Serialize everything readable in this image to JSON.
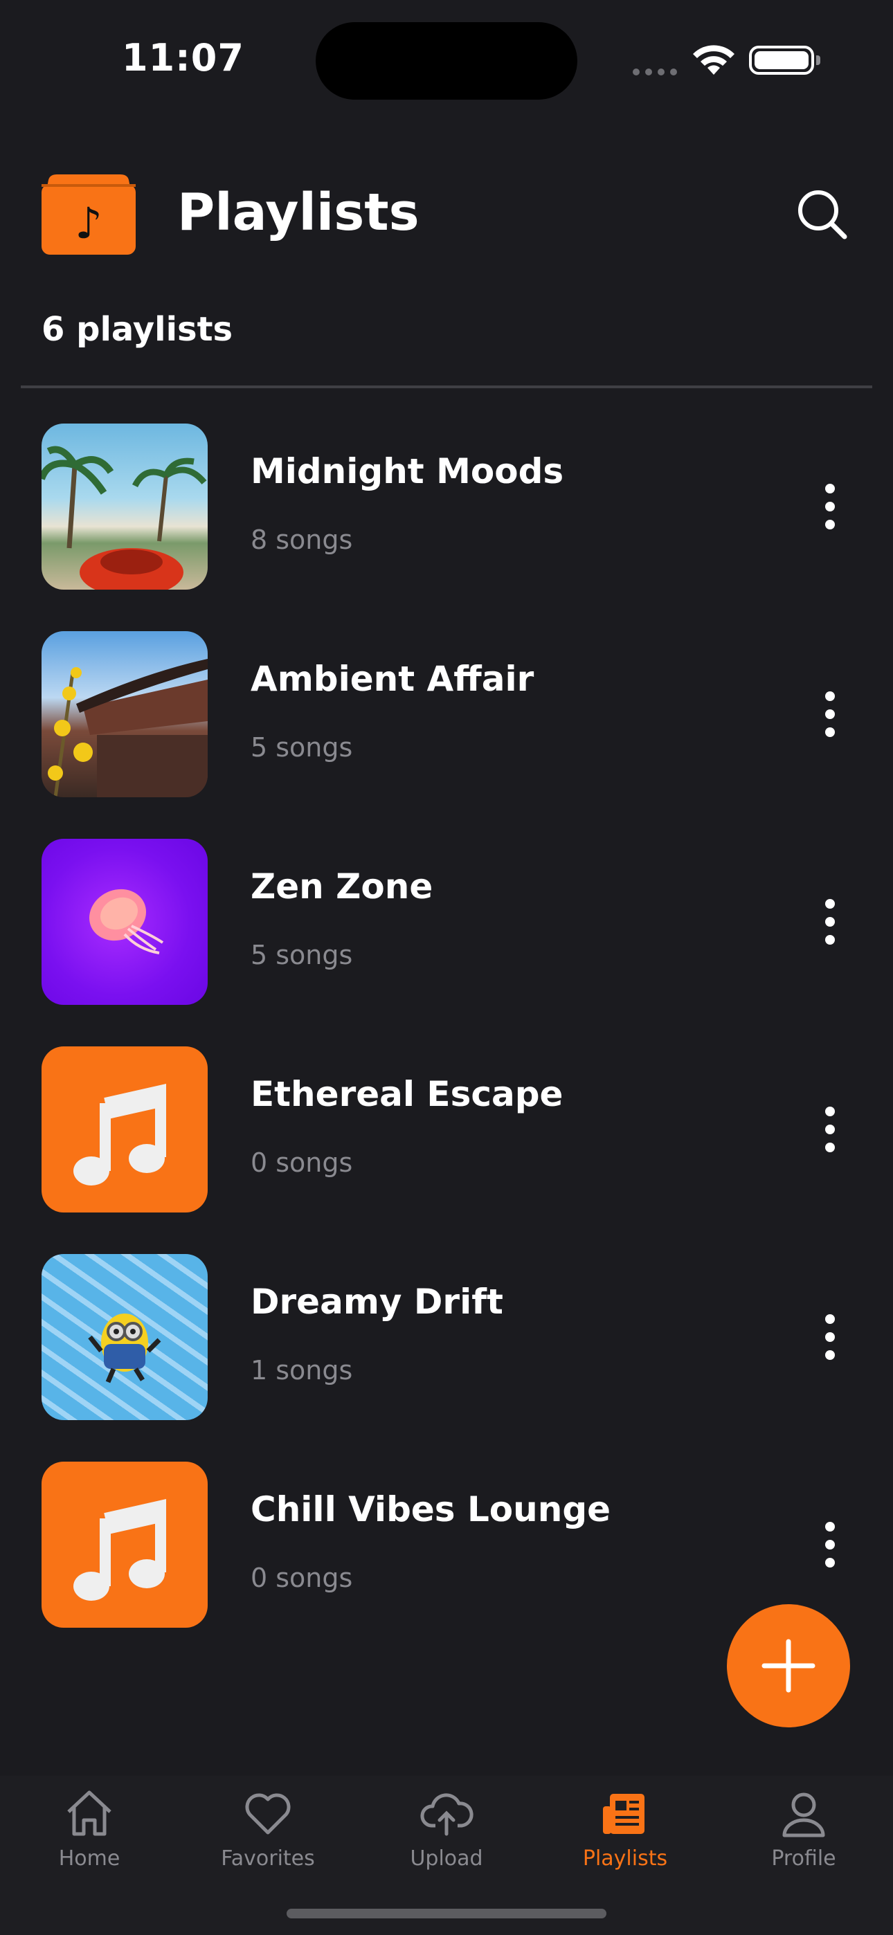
{
  "status": {
    "time": "11:07"
  },
  "header": {
    "title": "Playlists",
    "count_label": "6 playlists"
  },
  "playlists": [
    {
      "title": "Midnight Moods",
      "songs": "8 songs",
      "art": "photo-beach-car"
    },
    {
      "title": "Ambient Affair",
      "songs": "5 songs",
      "art": "photo-pagoda"
    },
    {
      "title": "Zen Zone",
      "songs": "5 songs",
      "art": "photo-jellyfish"
    },
    {
      "title": "Ethereal Escape",
      "songs": "0 songs",
      "art": "music-note-icon"
    },
    {
      "title": "Dreamy Drift",
      "songs": "1 songs",
      "art": "photo-minion-pool"
    },
    {
      "title": "Chill Vibes Lounge",
      "songs": "0 songs",
      "art": "music-note-icon"
    }
  ],
  "tabs": [
    {
      "label": "Home",
      "icon": "home-icon",
      "active": false
    },
    {
      "label": "Favorites",
      "icon": "heart-icon",
      "active": false
    },
    {
      "label": "Upload",
      "icon": "cloud-upload-icon",
      "active": false
    },
    {
      "label": "Playlists",
      "icon": "newspaper-icon",
      "active": true
    },
    {
      "label": "Profile",
      "icon": "person-icon",
      "active": false
    }
  ],
  "colors": {
    "accent": "#f97316",
    "background": "#1b1b1f",
    "muted_text": "#8a8a90"
  }
}
